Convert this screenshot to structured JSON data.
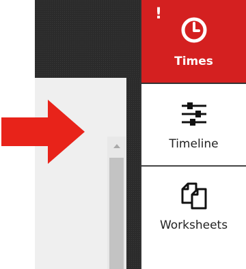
{
  "nav": {
    "items": [
      {
        "label": "Times",
        "icon": "clock-icon",
        "active": true,
        "badge": "!"
      },
      {
        "label": "Timeline",
        "icon": "sliders-icon",
        "active": false
      },
      {
        "label": "Worksheets",
        "icon": "documents-icon",
        "active": false
      }
    ]
  },
  "colors": {
    "accent": "#d42020",
    "arrow": "#e8231a",
    "dark_background": "#2b2b2b",
    "panel": "#efefef",
    "scrollbar_thumb": "#c3c3c3"
  }
}
